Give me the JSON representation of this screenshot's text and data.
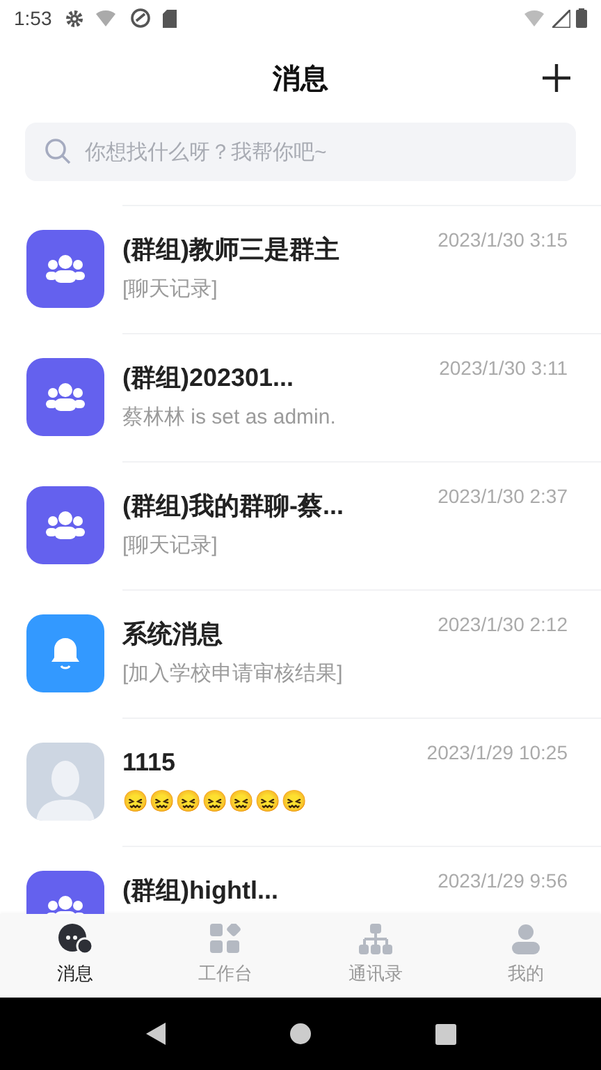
{
  "status_bar": {
    "time": "1:53"
  },
  "header": {
    "title": "消息"
  },
  "search": {
    "placeholder": "你想找什么呀？我帮你吧~"
  },
  "conversations": [
    {
      "kind": "group",
      "title": "(群组)教师三是群主",
      "time": "2023/1/30 3:15",
      "preview": "[聊天记录]"
    },
    {
      "kind": "group",
      "title": "(群组)202301...",
      "time": "2023/1/30 3:11",
      "preview": "蔡林林 is set as admin."
    },
    {
      "kind": "group",
      "title": "(群组)我的群聊-蔡...",
      "time": "2023/1/30 2:37",
      "preview": "[聊天记录]"
    },
    {
      "kind": "system",
      "title": "系统消息",
      "time": "2023/1/30 2:12",
      "preview": "[加入学校申请审核结果]"
    },
    {
      "kind": "contact",
      "title": "1115",
      "time": "2023/1/29 10:25",
      "preview": "😖😖😖😖😖😖😖"
    },
    {
      "kind": "group",
      "title": "(群组)hightl...",
      "time": "2023/1/29 9:56"
    }
  ],
  "tabs": [
    {
      "kind": "messages",
      "label": "消息",
      "selected": true
    },
    {
      "kind": "workbench",
      "label": "工作台",
      "selected": false
    },
    {
      "kind": "contacts",
      "label": "通讯录",
      "selected": false
    },
    {
      "kind": "me",
      "label": "我的",
      "selected": false
    }
  ]
}
